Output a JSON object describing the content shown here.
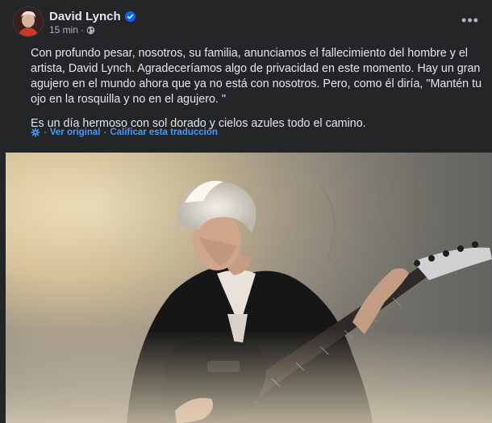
{
  "post": {
    "author": "David Lynch",
    "verified": true,
    "timestamp": "15 min",
    "audience_icon": "globe-icon",
    "menu_icon": "more-horizontal-icon",
    "paragraphs": [
      "Con profundo pesar, nosotros, su familia, anunciamos el fallecimiento del hombre y el artista, David Lynch. Agradeceríamos algo de privacidad en este momento. Hay un gran agujero en el mundo ahora que ya no está con nosotros. Pero, como él diría, \"Mantén tu ojo en la rosquilla y no en el agujero. \"",
      "Es un día hermoso con sol dorado y cielos azules todo el camino."
    ],
    "translation": {
      "icon": "gear-icon",
      "see_original": "Ver original",
      "separator": "·",
      "rate_translation": "Calificar esta traducción"
    }
  },
  "colors": {
    "background": "#242526",
    "primary_text": "#e4e6eb",
    "secondary_text": "#b0b3b8",
    "link": "#4599ff",
    "verified_badge": "#0866ff"
  }
}
